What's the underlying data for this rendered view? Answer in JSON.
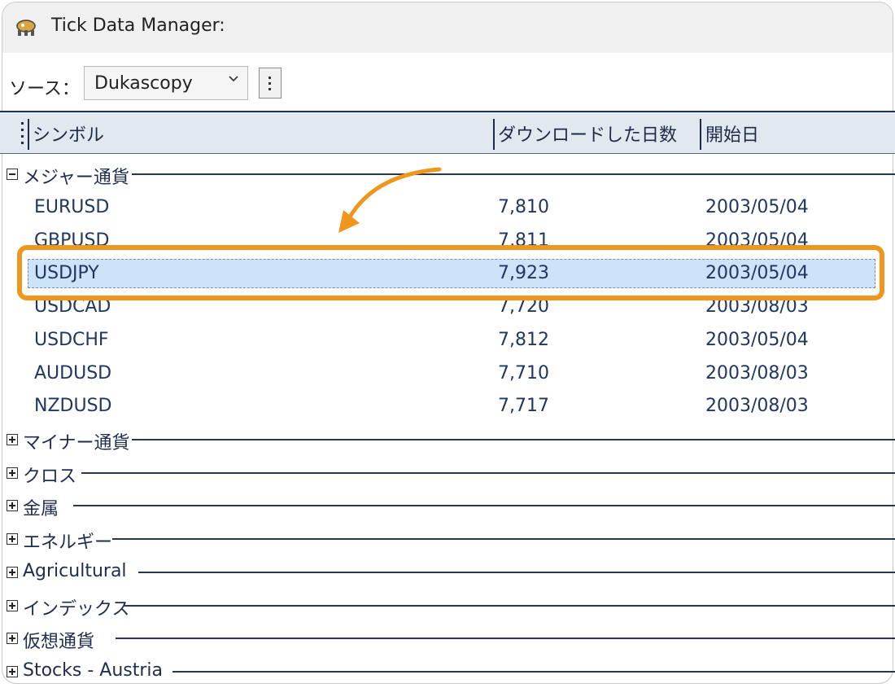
{
  "window": {
    "title": "Tick Data Manager:"
  },
  "source": {
    "label": "ソース：",
    "selected": "Dukascopy"
  },
  "columns": [
    "シンボル",
    "ダウンロードした日数",
    "開始日"
  ],
  "groups": [
    {
      "name": "メジャー通貨",
      "expanded": true
    },
    {
      "name": "マイナー通貨",
      "expanded": false
    },
    {
      "name": "クロス",
      "expanded": false
    },
    {
      "name": "金属",
      "expanded": false
    },
    {
      "name": "エネルギー",
      "expanded": false
    },
    {
      "name": "Agricultural",
      "expanded": false
    },
    {
      "name": "インデックス",
      "expanded": false
    },
    {
      "name": "仮想通貨",
      "expanded": false
    },
    {
      "name": "Stocks - Austria",
      "expanded": false
    }
  ],
  "rows": [
    {
      "symbol": "EURUSD",
      "days": "7,810",
      "start": "2003/05/04"
    },
    {
      "symbol": "GBPUSD",
      "days": "7,811",
      "start": "2003/05/04"
    },
    {
      "symbol": "USDJPY",
      "days": "7,923",
      "start": "2003/05/04",
      "selected": true
    },
    {
      "symbol": "USDCAD",
      "days": "7,720",
      "start": "2003/08/03"
    },
    {
      "symbol": "USDCHF",
      "days": "7,812",
      "start": "2003/05/04"
    },
    {
      "symbol": "AUDUSD",
      "days": "7,710",
      "start": "2003/08/03"
    },
    {
      "symbol": "NZDUSD",
      "days": "7,717",
      "start": "2003/08/03"
    }
  ],
  "colors": {
    "highlight": "#f0961d",
    "selection": "#cce3f9"
  }
}
